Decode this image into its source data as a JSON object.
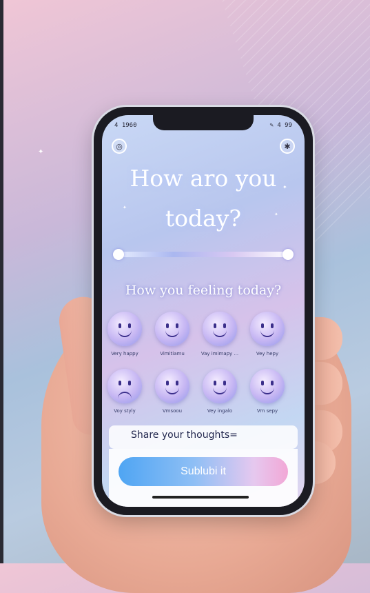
{
  "status": {
    "time": "4 1960",
    "right": "✎ 4 99"
  },
  "header": {
    "left_icon": "settings-circle-icon",
    "right_icon": "sparkle-icon"
  },
  "headline": {
    "line1": "How aro you",
    "line2": "today?"
  },
  "mood_slider": {
    "level": 0.95
  },
  "subheading": "How  you  feeling  today?",
  "moods": [
    {
      "label": "Very happy",
      "expression": "happy"
    },
    {
      "label": "Vimitiamu",
      "expression": "happy"
    },
    {
      "label": "Vay imimapy ...",
      "expression": "happy"
    },
    {
      "label": "Vey hepy",
      "expression": "happy"
    },
    {
      "label": "Voy styly",
      "expression": "sad"
    },
    {
      "label": "Vmsoou",
      "expression": "happy"
    },
    {
      "label": "Vey ingalo",
      "expression": "happy"
    },
    {
      "label": "Vm sepy",
      "expression": "happy"
    }
  ],
  "thoughts": {
    "placeholder": "Share your thoughts="
  },
  "submit": {
    "label": "Sublubi       it"
  },
  "colors": {
    "accent": "#4fa5f3",
    "accent_end": "#f2a7d6",
    "face_dark": "#3a2e8a"
  }
}
